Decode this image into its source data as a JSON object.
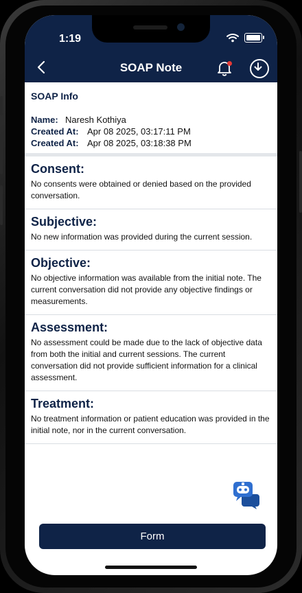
{
  "status_bar": {
    "time": "1:19"
  },
  "header": {
    "title": "SOAP Note"
  },
  "soap_info": {
    "heading": "SOAP Info",
    "name_label": "Name:",
    "name_value": "Naresh Kothiya",
    "created_label_1": "Created At:",
    "created_value_1": "Apr 08 2025, 03:17:11 PM",
    "created_label_2": "Created At:",
    "created_value_2": "Apr 08 2025, 03:18:38 PM"
  },
  "sections": [
    {
      "heading": "Consent:",
      "text": "No consents were obtained or denied based on the provided conversation."
    },
    {
      "heading": "Subjective:",
      "text": "No new information was provided during the current session."
    },
    {
      "heading": "Objective:",
      "text": "No objective information was available from the initial note. The current conversation did not provide any objective findings or measurements."
    },
    {
      "heading": "Assessment:",
      "text": "No assessment could be made due to the lack of objective data from both the initial and current sessions. The current conversation did not provide sufficient information for a clinical assessment."
    },
    {
      "heading": "Treatment:",
      "text": "No treatment information or patient education was provided in the initial note, nor in the current conversation."
    }
  ],
  "footer": {
    "form_button_label": "Form"
  },
  "icons": {
    "back": "chevron-left-icon",
    "notification": "bell-icon",
    "download": "download-icon",
    "chat": "chatbot-icon"
  },
  "colors": {
    "header_bg": "#0f2347",
    "accent": "#0f2347",
    "notification_dot": "#e53935",
    "chat_icon": "#2f6fd0"
  }
}
